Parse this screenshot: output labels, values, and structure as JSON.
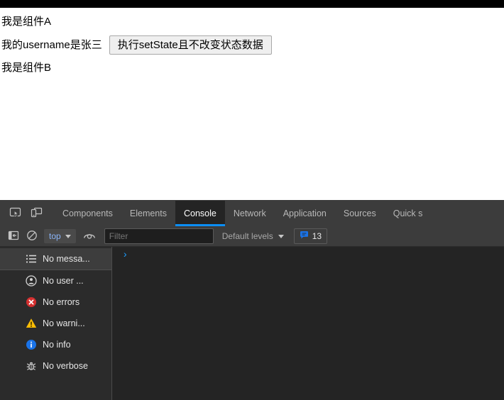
{
  "page": {
    "lines": [
      {
        "text": "我是组件A"
      },
      {
        "text": "我的username是张三"
      },
      {
        "text": "我是组件B"
      }
    ],
    "button_label": "执行setState且不改变状态数据"
  },
  "devtools": {
    "icons": {
      "inspect": "inspect-element-icon",
      "device": "device-toolbar-icon"
    },
    "tabs": [
      {
        "label": "Components",
        "active": false
      },
      {
        "label": "Elements",
        "active": false
      },
      {
        "label": "Console",
        "active": true
      },
      {
        "label": "Network",
        "active": false
      },
      {
        "label": "Application",
        "active": false
      },
      {
        "label": "Sources",
        "active": false
      },
      {
        "label": "Quick s",
        "active": false
      }
    ],
    "active_tab_accent": "#0b8ef5",
    "console_toolbar": {
      "sidebar_toggle_icon": "console-sidebar-toggle-icon",
      "clear_icon": "clear-console-icon",
      "context": "top",
      "eye_icon": "live-expression-eye-icon",
      "filter_placeholder": "Filter",
      "filter_value": "",
      "levels_label": "Default levels",
      "issues_icon": "issue-bubble-icon",
      "issues_count": "13",
      "issues_icon_color": "#1a73e8"
    },
    "sidebar": [
      {
        "icon": "message-list-icon",
        "label": "No messa...",
        "selected": true,
        "color": "#d5d5d5"
      },
      {
        "icon": "user-message-icon",
        "label": "No user ...",
        "selected": false,
        "color": "#d5d5d5"
      },
      {
        "icon": "error-icon",
        "label": "No errors",
        "selected": false,
        "color": "#d93025"
      },
      {
        "icon": "warning-icon",
        "label": "No warni...",
        "selected": false,
        "color": "#fbbc04"
      },
      {
        "icon": "info-icon",
        "label": "No info",
        "selected": false,
        "color": "#1a73e8"
      },
      {
        "icon": "verbose-bug-icon",
        "label": "No verbose",
        "selected": false,
        "color": "#d5d5d5"
      }
    ],
    "console_prompt_caret": "›"
  }
}
